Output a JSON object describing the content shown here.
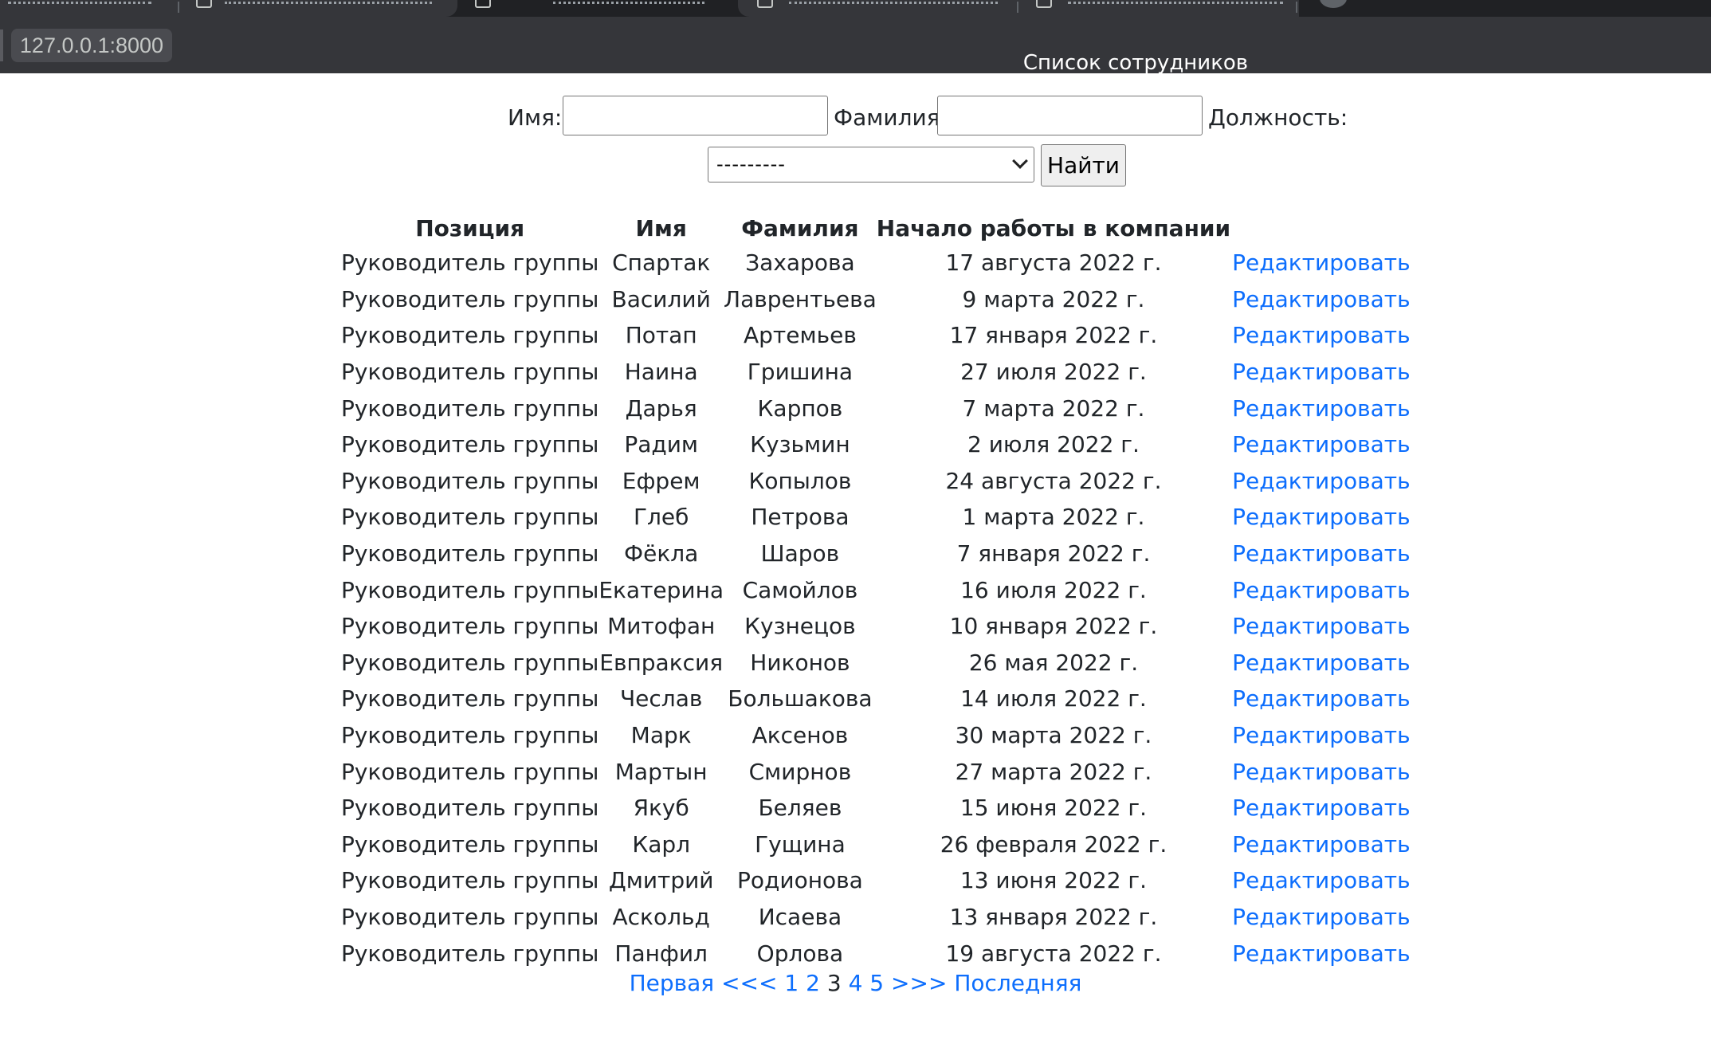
{
  "browser": {
    "url": "127.0.0.1:8000",
    "page_title": "Список сотрудников"
  },
  "search": {
    "first_name_label": "Имя:",
    "first_name_value": "",
    "last_name_label": "Фамилия:",
    "last_name_value": "",
    "position_label": "Должность:",
    "position_selected": "---------",
    "submit_label": "Найти"
  },
  "table": {
    "headers": [
      "Позиция",
      "Имя",
      "Фамилия",
      "Начало работы в компании",
      ""
    ],
    "edit_label": "Редактировать",
    "rows": [
      [
        "Руководитель группы",
        "Спартак",
        "Захарова",
        "17 августа 2022 г."
      ],
      [
        "Руководитель группы",
        "Василий",
        "Лаврентьева",
        "9 марта 2022 г."
      ],
      [
        "Руководитель группы",
        "Потап",
        "Артемьев",
        "17 января 2022 г."
      ],
      [
        "Руководитель группы",
        "Наина",
        "Гришина",
        "27 июля 2022 г."
      ],
      [
        "Руководитель группы",
        "Дарья",
        "Карпов",
        "7 марта 2022 г."
      ],
      [
        "Руководитель группы",
        "Радим",
        "Кузьмин",
        "2 июля 2022 г."
      ],
      [
        "Руководитель группы",
        "Ефрем",
        "Копылов",
        "24 августа 2022 г."
      ],
      [
        "Руководитель группы",
        "Глеб",
        "Петрова",
        "1 марта 2022 г."
      ],
      [
        "Руководитель группы",
        "Фёкла",
        "Шаров",
        "7 января 2022 г."
      ],
      [
        "Руководитель группы",
        "Екатерина",
        "Самойлов",
        "16 июля 2022 г."
      ],
      [
        "Руководитель группы",
        "Митофан",
        "Кузнецов",
        "10 января 2022 г."
      ],
      [
        "Руководитель группы",
        "Евпраксия",
        "Никонов",
        "26 мая 2022 г."
      ],
      [
        "Руководитель группы",
        "Чеслав",
        "Большакова",
        "14 июля 2022 г."
      ],
      [
        "Руководитель группы",
        "Марк",
        "Аксенов",
        "30 марта 2022 г."
      ],
      [
        "Руководитель группы",
        "Мартын",
        "Смирнов",
        "27 марта 2022 г."
      ],
      [
        "Руководитель группы",
        "Якуб",
        "Беляев",
        "15 июня 2022 г."
      ],
      [
        "Руководитель группы",
        "Карл",
        "Гущина",
        "26 февраля 2022 г."
      ],
      [
        "Руководитель группы",
        "Дмитрий",
        "Родионова",
        "13 июня 2022 г."
      ],
      [
        "Руководитель группы",
        "Аскольд",
        "Исаева",
        "13 января 2022 г."
      ],
      [
        "Руководитель группы",
        "Панфил",
        "Орлова",
        "19 августа 2022 г."
      ]
    ]
  },
  "pagination": {
    "first": "Первая",
    "prev": "<<<",
    "pages": [
      "1",
      "2",
      "3",
      "4",
      "5"
    ],
    "current": "3",
    "next": ">>>",
    "last": "Последняя"
  },
  "colors": {
    "link": "#0d6efd",
    "chrome_dark": "#202124",
    "chrome": "#35363a"
  }
}
